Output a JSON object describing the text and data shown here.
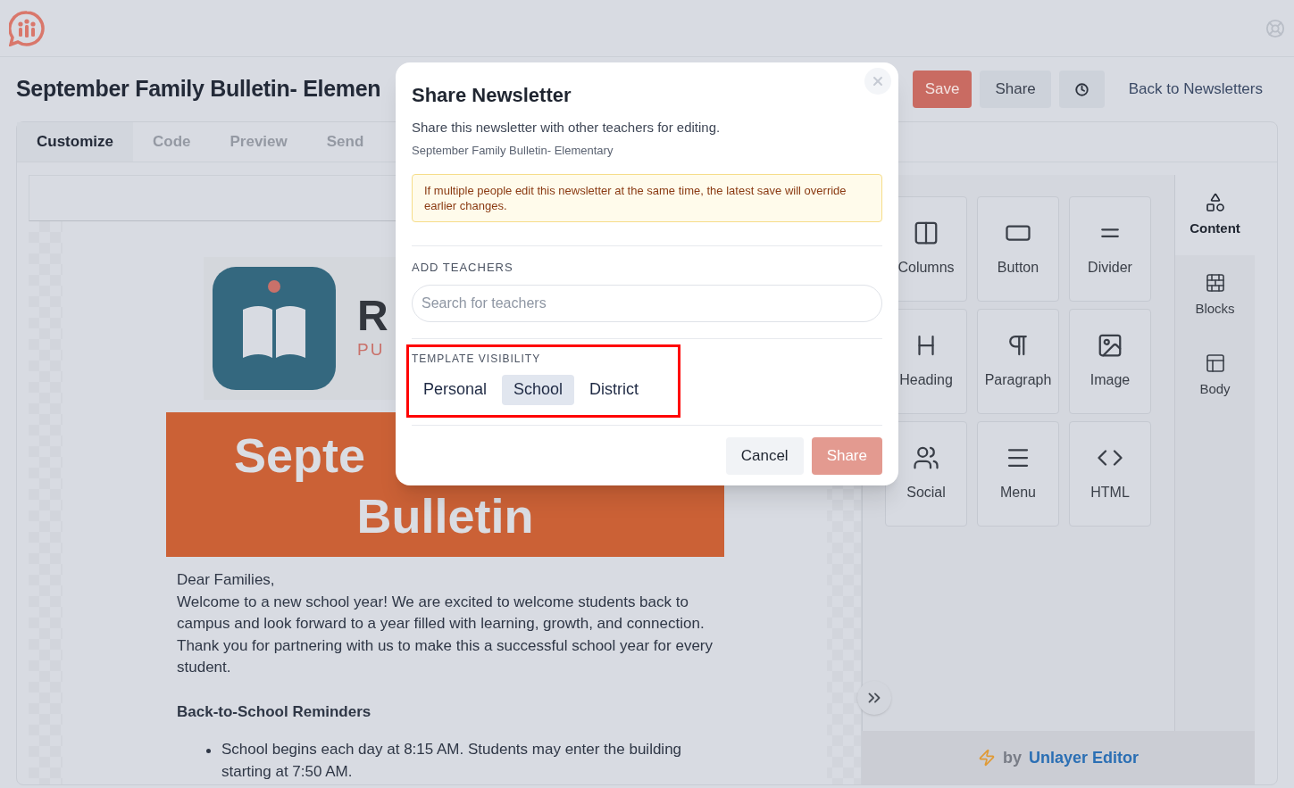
{
  "app": {
    "title": "September Family Bulletin- Elemen",
    "back_link": "Back to Newsletters"
  },
  "header_buttons": [
    {
      "kind": "primary",
      "label": "Save"
    },
    {
      "kind": "secondary",
      "label": "Share"
    },
    {
      "kind": "history"
    }
  ],
  "tabs": [
    {
      "label": "Customize",
      "selected": true
    },
    {
      "label": "Code",
      "selected": false
    },
    {
      "label": "Preview",
      "selected": false
    },
    {
      "label": "Send",
      "selected": false
    }
  ],
  "email": {
    "logo_letter": "R",
    "logo_tagline": "PU",
    "banner_lines": [
      "Septe",
      "Bulletin"
    ],
    "greeting": "Dear Families,",
    "intro": "Welcome to a new school year! We are excited to welcome students back to campus and look forward to a year filled with learning, growth, and connection. Thank you for partnering with us to make this a successful school year for every student.",
    "section_title": "Back-to-School Reminders",
    "bullets": [
      "School begins each day at 8:15 AM. Students may enter the building starting at 7:50 AM."
    ]
  },
  "tools": [
    {
      "label": "Columns",
      "kind": "columns"
    },
    {
      "label": "Button",
      "kind": "button"
    },
    {
      "label": "Divider",
      "kind": "divider"
    },
    {
      "label": "Heading",
      "kind": "heading"
    },
    {
      "label": "Paragraph",
      "kind": "paragraph"
    },
    {
      "label": "Image",
      "kind": "image"
    },
    {
      "label": "Social",
      "kind": "social"
    },
    {
      "label": "Menu",
      "kind": "menu"
    },
    {
      "label": "HTML",
      "kind": "html"
    }
  ],
  "side_tabs": [
    {
      "label": "Content",
      "kind": "content",
      "selected": true
    },
    {
      "label": "Blocks",
      "kind": "blocks",
      "selected": false
    },
    {
      "label": "Body",
      "kind": "body",
      "selected": false
    }
  ],
  "footer": {
    "by": "by",
    "brand": "Unlayer Editor"
  },
  "modal": {
    "title": "Share Newsletter",
    "subtitle": "Share this newsletter with other teachers for editing.",
    "newsletter": "September Family Bulletin- Elementary",
    "warning": "If multiple people edit this newsletter at the same time, the latest save will override earlier changes.",
    "add_label": "ADD TEACHERS",
    "search_placeholder": "Search for teachers",
    "visibility_label": "TEMPLATE VISIBILITY",
    "visibility_highlighted": true,
    "visibility_options": [
      {
        "label": "Personal",
        "selected": false
      },
      {
        "label": "School",
        "selected": true
      },
      {
        "label": "District",
        "selected": false
      }
    ],
    "buttons": [
      {
        "kind": "secondary",
        "label": "Cancel",
        "disabled": false
      },
      {
        "kind": "primary",
        "label": "Share",
        "disabled": true
      }
    ]
  }
}
